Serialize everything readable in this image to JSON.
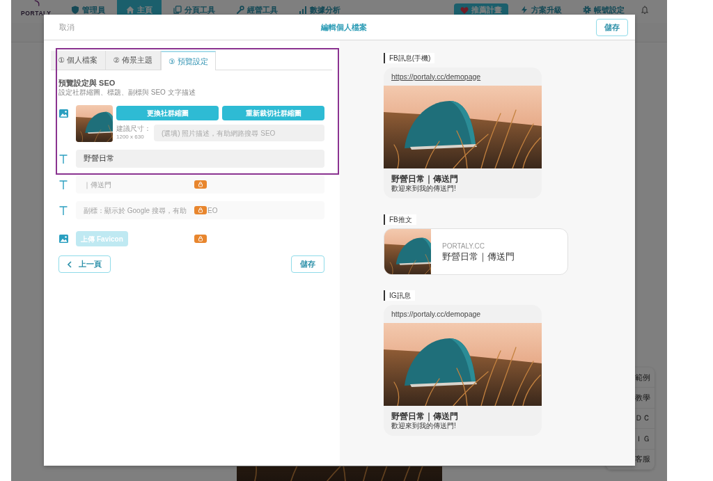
{
  "app_nav": {
    "logo": "PORTALY",
    "items": [
      {
        "label": "管理員",
        "selected": false
      },
      {
        "label": "主頁",
        "selected": true
      },
      {
        "label": "分頁工具",
        "selected": false
      },
      {
        "label": "經營工具",
        "selected": false
      },
      {
        "label": "數據分析",
        "selected": false
      }
    ],
    "referral_button": "推薦計畫",
    "links": [
      "方案升級",
      "帳號設定"
    ]
  },
  "floating_menu": {
    "items": [
      "範例",
      "教學",
      "ＤＣ",
      "ＩＧ",
      "客服"
    ]
  },
  "modal": {
    "cancel": "取消",
    "title": "編輯個人檔案",
    "save": "儲存"
  },
  "editor": {
    "highlight": true,
    "tabs": [
      {
        "label": "① 個人檔案",
        "selected": false
      },
      {
        "label": "② 佈景主題",
        "selected": false
      },
      {
        "label": "③ 預覽設定",
        "selected": true
      }
    ],
    "section_title": "預覽設定與 SEO",
    "section_description": "設定社群縮圖、標題、副標與 SEO 文字描述",
    "cover": {
      "buttons": [
        "更換社群縮圖",
        "重新裁切社群縮圖"
      ],
      "size_label": "建議尺寸：",
      "size_value": "1200 x 630",
      "alt_placeholder": "(選填) 照片描述，有助網路搜尋 SEO"
    },
    "fields": [
      {
        "kind": "text",
        "value": "野營日常",
        "locked": false
      },
      {
        "kind": "text",
        "placeholder": "｜傳送門",
        "locked": true
      },
      {
        "kind": "text",
        "placeholder": "副標：顯示於 Google 搜尋，有助",
        "placeholder_after_lock": "EO",
        "locked": true
      },
      {
        "kind": "upload",
        "button": "上傳 Favicon",
        "locked": true
      }
    ],
    "back_button": "上一頁",
    "save_button": "儲存"
  },
  "preview": {
    "sections": [
      {
        "kind": "fb_message",
        "label": "FB訊息(手機)",
        "url": "https://portaly.cc/demopage",
        "title": "野營日常｜傳送門",
        "description": "歡迎來到我的傳送門!"
      },
      {
        "kind": "fb_post",
        "label": "FB推文",
        "domain": "PORTALY.CC",
        "title": "野營日常｜傳送門"
      },
      {
        "kind": "ig_message",
        "label": "IG訊息",
        "url": "https://portaly.cc/demopage",
        "title": "野營日常｜傳送門",
        "description": "歡迎來到我的傳送門!"
      }
    ]
  }
}
